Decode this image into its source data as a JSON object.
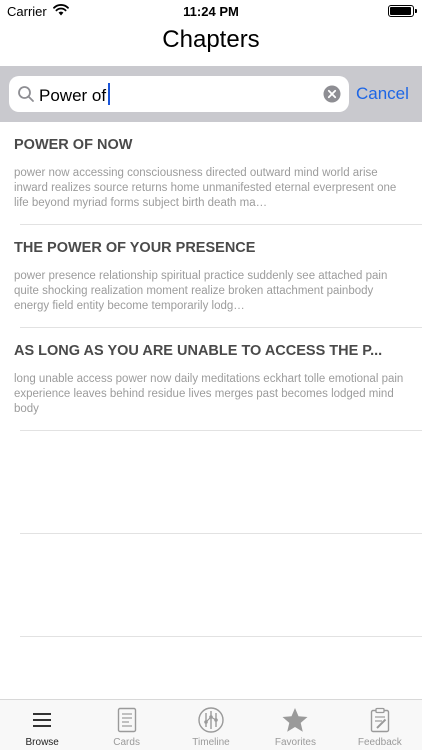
{
  "status_bar": {
    "carrier": "Carrier",
    "time": "11:24 PM",
    "battery_level": 0.95
  },
  "nav": {
    "title": "Chapters"
  },
  "search": {
    "value": "Power of",
    "cancel_label": "Cancel"
  },
  "results": [
    {
      "title": "POWER OF NOW",
      "description": "power now accessing consciousness directed outward mind world arise inward realizes source returns home unmanifested eternal everpresent one life beyond myriad forms subject birth death ma…"
    },
    {
      "title": "THE POWER OF YOUR PRESENCE",
      "description": "power presence relationship spiritual practice suddenly see attached pain quite shocking realization moment realize broken attachment painbody energy field entity become temporarily lodg…"
    },
    {
      "title": "AS LONG AS YOU ARE UNABLE TO ACCESS THE P...",
      "description": "long unable access power now daily meditations eckhart tolle emotional pain experience leaves behind residue lives merges past becomes lodged mind body"
    }
  ],
  "tabs": [
    {
      "label": "Browse",
      "icon": "list-icon",
      "active": true
    },
    {
      "label": "Cards",
      "icon": "cards-icon",
      "active": false
    },
    {
      "label": "Timeline",
      "icon": "timeline-icon",
      "active": false
    },
    {
      "label": "Favorites",
      "icon": "star-icon",
      "active": false
    },
    {
      "label": "Feedback",
      "icon": "clipboard-icon",
      "active": false
    }
  ],
  "colors": {
    "accent": "#1d66e6",
    "search_bg": "#c9c9ce",
    "title_text": "#4a4a4a",
    "desc_text": "#9c9c9c"
  }
}
